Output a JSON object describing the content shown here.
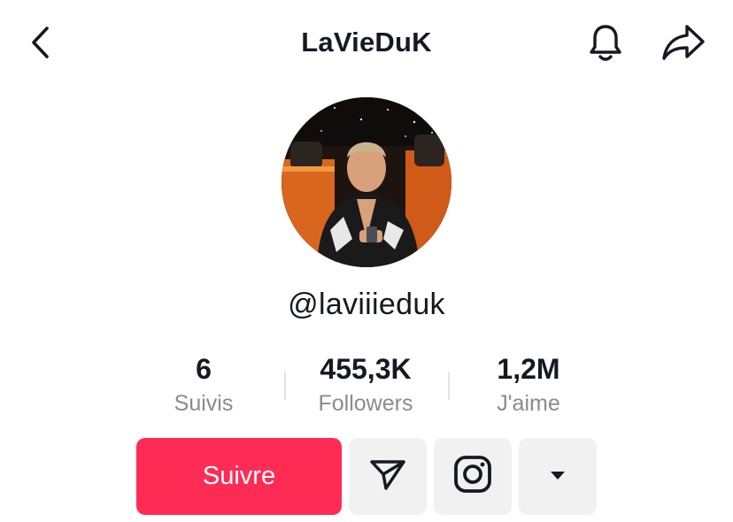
{
  "header": {
    "title": "LaVieDuK",
    "back_icon": "chevron-left-icon",
    "bell_icon": "bell-icon",
    "share_icon": "share-arrow-icon"
  },
  "profile": {
    "handle": "@laviiieduk",
    "avatar": "profile-photo"
  },
  "stats": [
    {
      "value": "6",
      "label": "Suivis"
    },
    {
      "value": "455,3K",
      "label": "Followers"
    },
    {
      "value": "1,2M",
      "label": "J'aime"
    }
  ],
  "actions": {
    "follow_label": "Suivre",
    "message_icon": "send-message-icon",
    "instagram_icon": "instagram-icon",
    "more_icon": "caret-down-icon"
  },
  "colors": {
    "accent": "#fe2c55",
    "secondary_button": "#f1f1f2",
    "label_gray": "#8a8b91",
    "text": "#161823"
  }
}
